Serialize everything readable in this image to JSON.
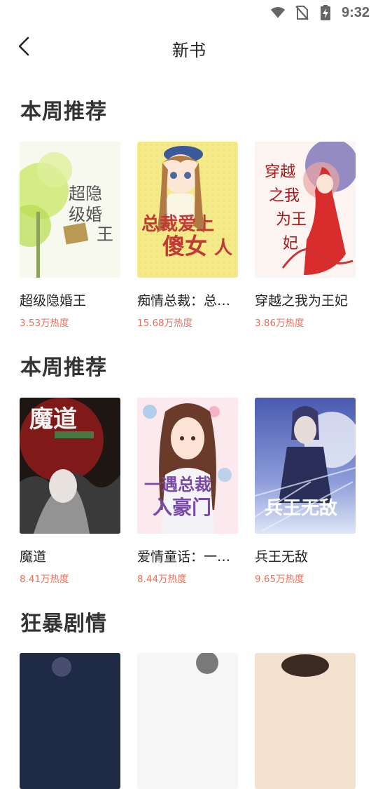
{
  "status_bar": {
    "time": "9:32",
    "icons": [
      "wifi-icon",
      "no-sim-icon",
      "battery-charging-icon"
    ]
  },
  "header": {
    "title": "新书",
    "back_icon": "chevron-left-icon"
  },
  "sections": [
    {
      "title": "本周推荐",
      "books": [
        {
          "name": "超级隐婚王",
          "heat": "3.53万热度",
          "cover_text": [
            "超隐",
            "级婚",
            "王"
          ]
        },
        {
          "name": "痴情总裁：总…",
          "heat": "15.68万热度",
          "cover_text": [
            "总裁爱上",
            "傻女",
            "人"
          ]
        },
        {
          "name": "穿越之我为王妃",
          "heat": "3.86万热度",
          "cover_text": [
            "穿越",
            "之我",
            "为王",
            "妃"
          ]
        }
      ]
    },
    {
      "title": "本周推荐",
      "books": [
        {
          "name": "魔道",
          "heat": "8.41万热度",
          "cover_text": [
            "魔道"
          ]
        },
        {
          "name": "爱情童话：一…",
          "heat": "8.44万热度",
          "cover_text": [
            "一遇总裁",
            "入豪门"
          ]
        },
        {
          "name": "兵王无敌",
          "heat": "9.65万热度",
          "cover_text": [
            "兵王无敌"
          ]
        }
      ]
    },
    {
      "title": "狂暴剧情",
      "books": []
    }
  ],
  "colors": {
    "heat_text": "#e8725a",
    "title_text": "#333333"
  }
}
